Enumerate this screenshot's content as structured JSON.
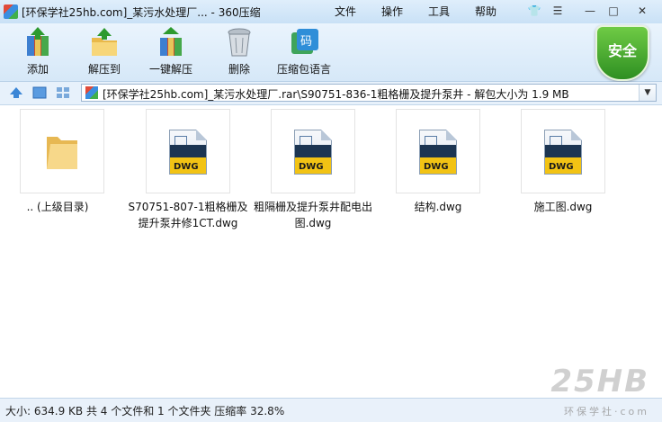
{
  "window": {
    "title": "[环保学社25hb.com]_某污水处理厂... - 360压缩",
    "menus": [
      "文件",
      "操作",
      "工具",
      "帮助"
    ]
  },
  "toolbar": {
    "items": [
      {
        "label": "添加",
        "icon": "add-archive-icon"
      },
      {
        "label": "解压到",
        "icon": "extract-to-icon"
      },
      {
        "label": "一键解压",
        "icon": "one-click-extract-icon"
      },
      {
        "label": "删除",
        "icon": "delete-trash-icon"
      },
      {
        "label": "压缩包语言",
        "icon": "archive-language-icon"
      }
    ],
    "security_badge": "安全"
  },
  "address": {
    "path": "[环保学社25hb.com]_某污水处理厂.rar\\S90751-836-1粗格栅及提升泵井 - 解包大小为 1.9 MB"
  },
  "files": [
    {
      "name": ".. (上级目录)",
      "type": "folder"
    },
    {
      "name": "S70751-807-1粗格栅及提升泵井修1CT.dwg",
      "type": "dwg"
    },
    {
      "name": "粗隔栅及提升泵井配电出图.dwg",
      "type": "dwg"
    },
    {
      "name": "结构.dwg",
      "type": "dwg"
    },
    {
      "name": "施工图.dwg",
      "type": "dwg"
    }
  ],
  "dwg_badge": "DWG",
  "status": {
    "text": "大小: 634.9 KB 共 4 个文件和 1 个文件夹 压缩率 32.8%"
  },
  "watermark": {
    "logo": "25HB",
    "sub": "环保学社·com"
  },
  "colors": {
    "accent": "#2e8f22",
    "titlebar": "#c9e1f6",
    "dwg_yellow": "#f2c314"
  }
}
